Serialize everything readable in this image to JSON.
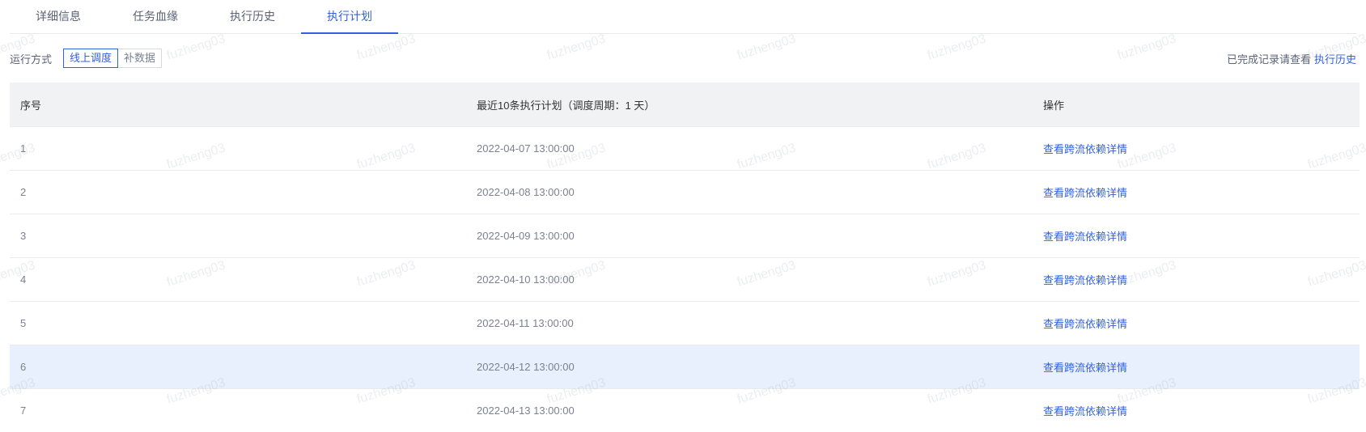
{
  "tabs": [
    {
      "label": "详细信息",
      "active": false
    },
    {
      "label": "任务血缘",
      "active": false
    },
    {
      "label": "执行历史",
      "active": false
    },
    {
      "label": "执行计划",
      "active": true
    }
  ],
  "run_mode": {
    "label": "运行方式",
    "options": [
      {
        "label": "线上调度",
        "active": true
      },
      {
        "label": "补数据",
        "active": false
      }
    ]
  },
  "history_note": {
    "text": "已完成记录请查看",
    "link": "执行历史"
  },
  "table": {
    "columns": [
      "序号",
      "最近10条执行计划（调度周期：1 天）",
      "操作"
    ],
    "rows": [
      {
        "index": "1",
        "time": "2022-04-07 13:00:00",
        "action": "查看跨流依赖详情"
      },
      {
        "index": "2",
        "time": "2022-04-08 13:00:00",
        "action": "查看跨流依赖详情"
      },
      {
        "index": "3",
        "time": "2022-04-09 13:00:00",
        "action": "查看跨流依赖详情"
      },
      {
        "index": "4",
        "time": "2022-04-10 13:00:00",
        "action": "查看跨流依赖详情"
      },
      {
        "index": "5",
        "time": "2022-04-11 13:00:00",
        "action": "查看跨流依赖详情"
      },
      {
        "index": "6",
        "time": "2022-04-12 13:00:00",
        "action": "查看跨流依赖详情"
      },
      {
        "index": "7",
        "time": "2022-04-13 13:00:00",
        "action": "查看跨流依赖详情"
      }
    ],
    "highlighted_row": 5
  },
  "watermark": "fuzheng03",
  "colors": {
    "accent": "#3360dd",
    "header_bg": "#f1f2f4",
    "highlight_row_bg": "#e9f0fd"
  }
}
